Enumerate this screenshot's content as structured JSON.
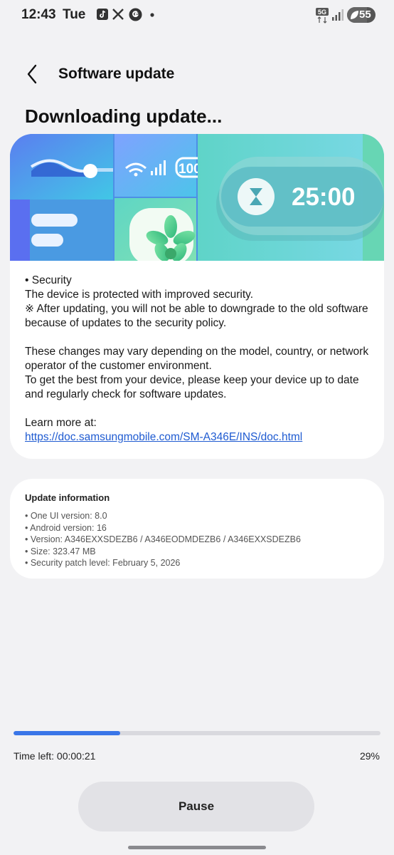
{
  "status_bar": {
    "time": "12:43",
    "day": "Tue",
    "network": "5G",
    "battery": "55"
  },
  "header": {
    "title": "Software update"
  },
  "heading": "Downloading update...",
  "banner": {
    "wifi_value": "100",
    "timer": "25:00"
  },
  "notes": {
    "security_title": "• Security",
    "security_line": "The device is protected with improved security.",
    "downgrade_note": "※ After updating, you will not be able to downgrade to the old software because of updates to the security policy.",
    "changes_note": "These changes may vary depending on the model, country, or network operator of the customer environment.",
    "best_note": "To get the best from your device, please keep your device up to date and regularly check for software updates.",
    "learn_more_label": "Learn more at:",
    "learn_more_link": "https://doc.samsungmobile.com/SM-A346E/INS/doc.html"
  },
  "update_info": {
    "title": "Update information",
    "items": [
      "• One UI version: 8.0",
      "• Android version: 16",
      "• Version: A346EXXSDEZB6 / A346EODMDEZB6 / A346EXXSDEZB6",
      "• Size: 323.47 MB",
      "• Security patch level: February 5, 2026"
    ]
  },
  "progress": {
    "fraction": 0.29,
    "time_left": "Time left: 00:00:21",
    "percent_label": "29%"
  },
  "actions": {
    "pause_label": "Pause"
  },
  "colors": {
    "accent": "#3a76e8",
    "link": "#1f5bd1",
    "background": "#f2f2f4"
  }
}
